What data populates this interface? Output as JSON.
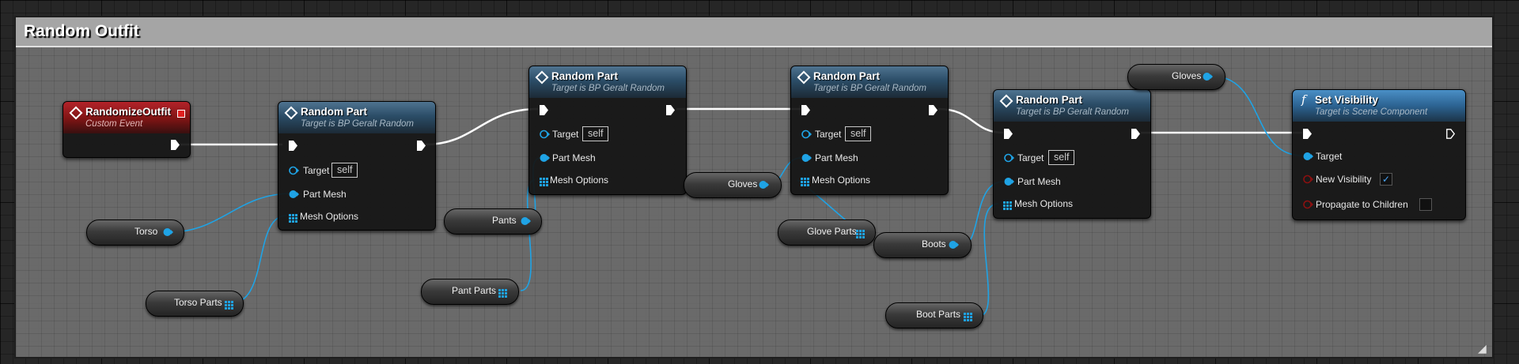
{
  "comment": {
    "title": "Random Outfit"
  },
  "event_node": {
    "title": "RandomizeOutfit",
    "subtitle": "Custom Event"
  },
  "random_part_nodes": [
    {
      "title": "Random Part",
      "subtitle": "Target is BP Geralt Random",
      "target_label": "Target",
      "target_value": "self",
      "part_mesh_label": "Part Mesh",
      "mesh_options_label": "Mesh Options"
    },
    {
      "title": "Random Part",
      "subtitle": "Target is BP Geralt Random",
      "target_label": "Target",
      "target_value": "self",
      "part_mesh_label": "Part Mesh",
      "mesh_options_label": "Mesh Options"
    },
    {
      "title": "Random Part",
      "subtitle": "Target is BP Geralt Random",
      "target_label": "Target",
      "target_value": "self",
      "part_mesh_label": "Part Mesh",
      "mesh_options_label": "Mesh Options"
    },
    {
      "title": "Random Part",
      "subtitle": "Target is BP Geralt Random",
      "target_label": "Target",
      "target_value": "self",
      "part_mesh_label": "Part Mesh",
      "mesh_options_label": "Mesh Options"
    }
  ],
  "set_visibility_node": {
    "title": "Set Visibility",
    "subtitle": "Target is Scene Component",
    "target_label": "Target",
    "new_visibility_label": "New Visibility",
    "new_visibility_checked": true,
    "propagate_label": "Propagate to Children",
    "propagate_checked": false
  },
  "variables": {
    "torso": "Torso",
    "torso_parts": "Torso Parts",
    "pants": "Pants",
    "pant_parts": "Pant Parts",
    "gloves_mid": "Gloves",
    "glove_parts": "Glove Parts",
    "boots": "Boots",
    "boot_parts": "Boot Parts",
    "gloves_top": "Gloves"
  },
  "icons": {
    "event": "event-diamond-icon",
    "function": "function-icon",
    "exec": "exec-pin-icon",
    "object": "object-pin-icon",
    "array": "array-grid-icon"
  },
  "colors": {
    "object_pin": "#1fa3e5",
    "exec_wire": "#ffffff",
    "event_header": "#9e1b1f",
    "function_header": "#2c6392",
    "check": "#4aa8ff"
  }
}
